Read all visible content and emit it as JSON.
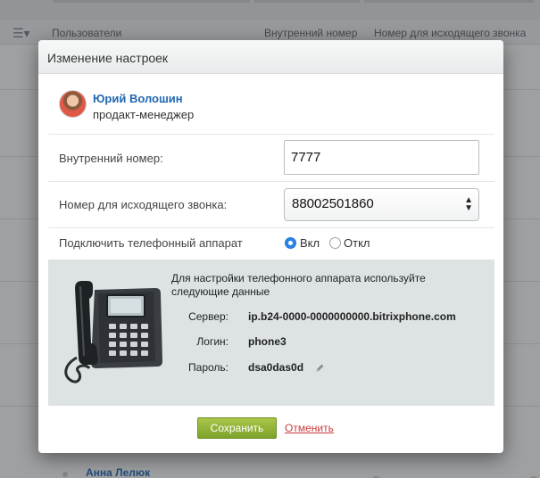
{
  "background": {
    "columns": [
      "Пользователи",
      "Внутренний номер",
      "Номер для исходящего звонка"
    ],
    "bottom_row": {
      "name": "Анна Лелюк",
      "dash1": "–",
      "dash2": "–"
    }
  },
  "dialog": {
    "title": "Изменение настроек",
    "user": {
      "name": "Юрий Волошин",
      "role": "продакт-менеджер"
    },
    "fields": {
      "extension_label": "Внутренний номер:",
      "extension_value": "7777",
      "outgoing_label": "Номер для исходящего звонка:",
      "outgoing_value": "88002501860",
      "phone_label": "Подключить телефонный аппарат",
      "phone_on_label": "Вкл",
      "phone_off_label": "Откл",
      "phone_selected": "Вкл"
    },
    "phone_setup": {
      "intro": "Для настройки телефонного аппарата используйте следующие данные",
      "server_label": "Сервер:",
      "server_value": "ip.b24-0000-0000000000.bitrixphone.com",
      "login_label": "Логин:",
      "login_value": "phone3",
      "password_label": "Пароль:",
      "password_value": "dsa0das0d"
    },
    "buttons": {
      "save": "Сохранить",
      "cancel": "Отменить"
    }
  },
  "colors": {
    "accent_blue": "#2067b0",
    "save_green": "#8cb034",
    "cancel_red": "#c83c3c",
    "panel_bg": "#dde2e3"
  }
}
